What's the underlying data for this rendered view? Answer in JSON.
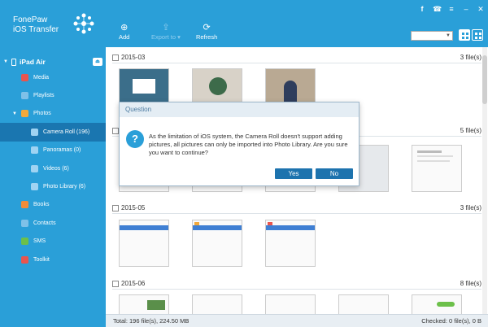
{
  "app": {
    "title_line1": "FonePaw",
    "title_line2": "iOS Transfer"
  },
  "window_icons": [
    "facebook-icon",
    "feedback-icon",
    "menu-icon",
    "minimize-icon",
    "close-icon"
  ],
  "toolbar": {
    "add_label": "Add",
    "export_label": "Export to",
    "refresh_label": "Refresh"
  },
  "device": {
    "name": "iPad Air"
  },
  "sidebar": {
    "items": [
      {
        "label": "Media",
        "icon": "music-icon",
        "color": "#e8554e",
        "level": 1
      },
      {
        "label": "Playlists",
        "icon": "playlist-icon",
        "color": "#7fc1e8",
        "level": 1
      },
      {
        "label": "Photos",
        "icon": "photo-icon",
        "color": "#f2a93b",
        "level": 1,
        "expanded": true
      },
      {
        "label": "Camera Roll (196)",
        "icon": "camera-icon",
        "color": "#9fd3f2",
        "level": 2,
        "active": true
      },
      {
        "label": "Panoramas (0)",
        "icon": "panorama-icon",
        "color": "#9fd3f2",
        "level": 2
      },
      {
        "label": "Videos (6)",
        "icon": "video-icon",
        "color": "#9fd3f2",
        "level": 2
      },
      {
        "label": "Photo Library (6)",
        "icon": "library-icon",
        "color": "#9fd3f2",
        "level": 2
      },
      {
        "label": "Books",
        "icon": "book-icon",
        "color": "#f08c3a",
        "level": 1
      },
      {
        "label": "Contacts",
        "icon": "contacts-icon",
        "color": "#7fc1e8",
        "level": 1
      },
      {
        "label": "SMS",
        "icon": "sms-icon",
        "color": "#6cc04a",
        "level": 1
      },
      {
        "label": "Toolkit",
        "icon": "toolkit-icon",
        "color": "#e8554e",
        "level": 1
      }
    ]
  },
  "groups": [
    {
      "date": "2015-03",
      "count": "3 file(s)"
    },
    {
      "date": "",
      "count": "5 file(s)"
    },
    {
      "date": "2015-05",
      "count": "3 file(s)"
    },
    {
      "date": "2015-06",
      "count": "8 file(s)"
    }
  ],
  "status": {
    "total": "Total: 196 file(s), 224.50 MB",
    "checked": "Checked: 0 file(s), 0 B"
  },
  "dialog": {
    "title": "Question",
    "message": "As the limitation of iOS system, the Camera Roll doesn't support adding pictures, all pictures can only be imported into Photo Library. Are you sure you want to continue?",
    "yes_label": "Yes",
    "no_label": "No"
  },
  "colors": {
    "sidebar": "#2a9fd8",
    "active": "#1a76b0",
    "button": "#1d73ae"
  }
}
